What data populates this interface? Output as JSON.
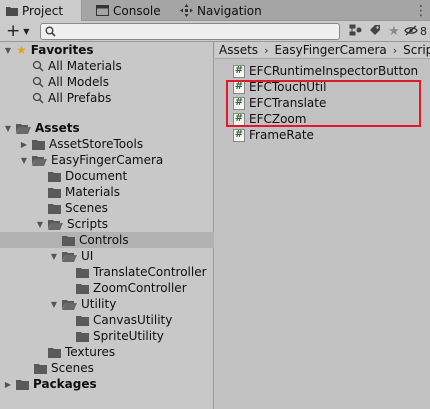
{
  "tabs": [
    {
      "label": "Project",
      "icon": "folder-icon"
    },
    {
      "label": "Console",
      "icon": "console-icon"
    },
    {
      "label": "Navigation",
      "icon": "navigation-icon"
    }
  ],
  "toolbar": {
    "create_label": "+",
    "search_placeholder": "",
    "search_value": "",
    "hidden_count": "8"
  },
  "tree": {
    "favorites": {
      "label": "Favorites",
      "items": [
        "All Materials",
        "All Models",
        "All Prefabs"
      ]
    },
    "assets_label": "Assets",
    "asset_store_tools": "AssetStoreTools",
    "easy_finger_camera": "EasyFingerCamera",
    "document": "Document",
    "materials": "Materials",
    "scenes_sub": "Scenes",
    "scripts": "Scripts",
    "controls": "Controls",
    "ui": "UI",
    "translate_controller": "TranslateController",
    "zoom_controller": "ZoomController",
    "utility": "Utility",
    "canvas_utility": "CanvasUtility",
    "sprite_utility": "SpriteUtility",
    "textures": "Textures",
    "scenes": "Scenes",
    "packages": "Packages"
  },
  "breadcrumb": [
    "Assets",
    "EasyFingerCamera",
    "Scripts"
  ],
  "files": [
    {
      "name": "EFCRuntimeInspectorButton",
      "icon": "csharp-script-icon",
      "highlighted": false
    },
    {
      "name": "EFCTouchUtil",
      "icon": "csharp-script-icon",
      "highlighted": true
    },
    {
      "name": "EFCTranslate",
      "icon": "csharp-script-icon",
      "highlighted": true
    },
    {
      "name": "EFCZoom",
      "icon": "csharp-script-icon",
      "highlighted": true
    },
    {
      "name": "FrameRate",
      "icon": "csharp-script-icon",
      "highlighted": false
    }
  ],
  "colors": {
    "highlight_border": "#e0192c",
    "favorites_star": "#e2a21a",
    "folder": "#5a5a5a"
  }
}
